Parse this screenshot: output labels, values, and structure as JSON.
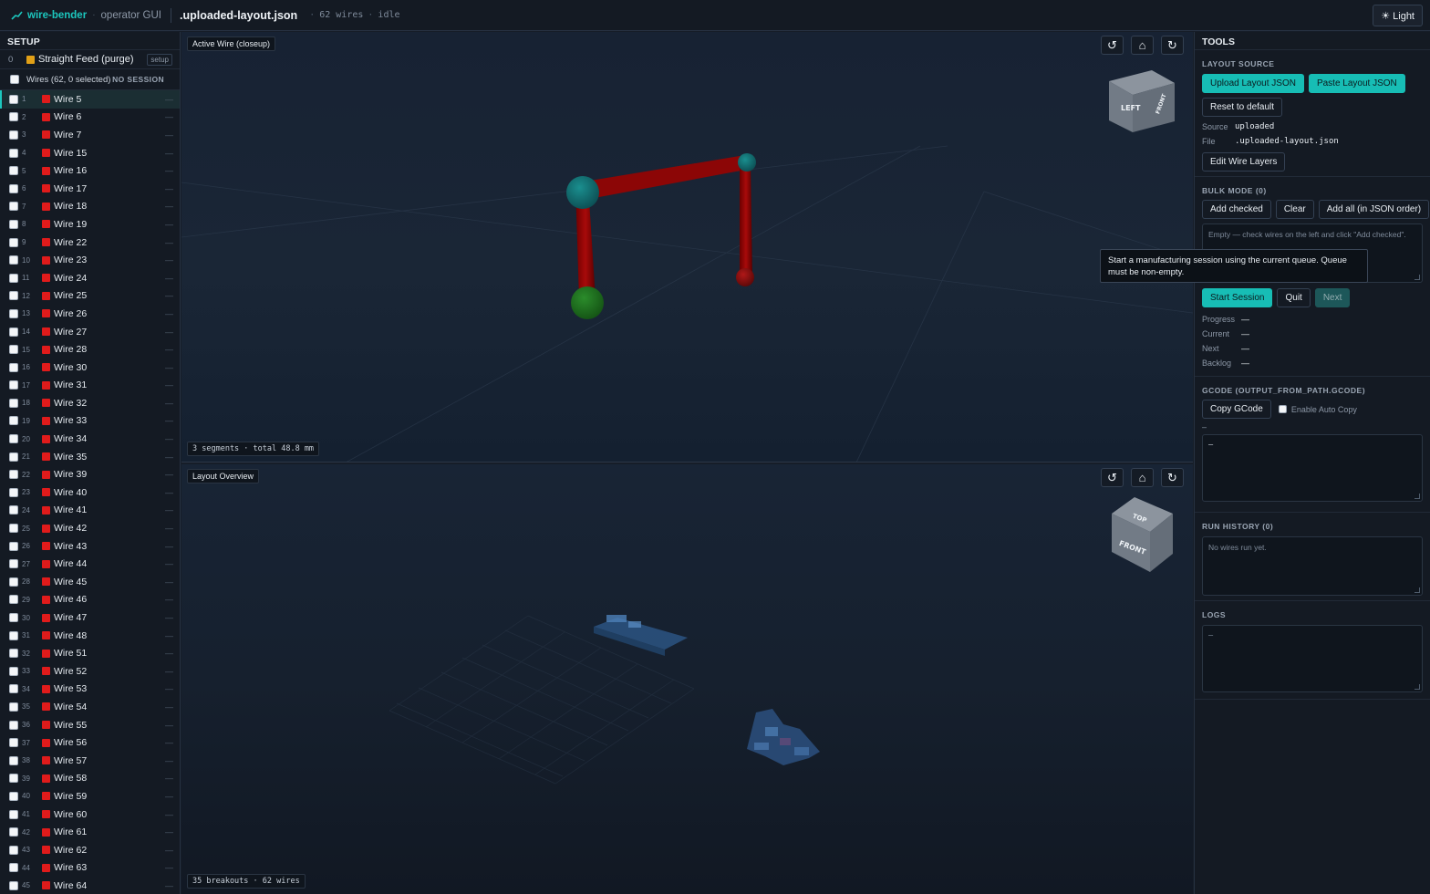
{
  "topbar": {
    "brand": "wire-bender",
    "subtitle": "operator GUI",
    "filename": ".uploaded-layout.json",
    "wire_count": "62 wires",
    "status": "idle",
    "theme_button": "☀ Light"
  },
  "sidebar": {
    "title": "SETUP",
    "setup_item": {
      "index": "0",
      "label": "Straight Feed (purge)",
      "tag": "setup",
      "color": "#e1a017"
    },
    "wires_header": {
      "label": "Wires (62, 0 selected)",
      "session": "NO SESSION"
    },
    "wire_color": "#e01b1b",
    "active_index": 0,
    "wires": [
      {
        "n": "1",
        "name": "Wire 5"
      },
      {
        "n": "2",
        "name": "Wire 6"
      },
      {
        "n": "3",
        "name": "Wire 7"
      },
      {
        "n": "4",
        "name": "Wire 15"
      },
      {
        "n": "5",
        "name": "Wire 16"
      },
      {
        "n": "6",
        "name": "Wire 17"
      },
      {
        "n": "7",
        "name": "Wire 18"
      },
      {
        "n": "8",
        "name": "Wire 19"
      },
      {
        "n": "9",
        "name": "Wire 22"
      },
      {
        "n": "10",
        "name": "Wire 23"
      },
      {
        "n": "11",
        "name": "Wire 24"
      },
      {
        "n": "12",
        "name": "Wire 25"
      },
      {
        "n": "13",
        "name": "Wire 26"
      },
      {
        "n": "14",
        "name": "Wire 27"
      },
      {
        "n": "15",
        "name": "Wire 28"
      },
      {
        "n": "16",
        "name": "Wire 30"
      },
      {
        "n": "17",
        "name": "Wire 31"
      },
      {
        "n": "18",
        "name": "Wire 32"
      },
      {
        "n": "19",
        "name": "Wire 33"
      },
      {
        "n": "20",
        "name": "Wire 34"
      },
      {
        "n": "21",
        "name": "Wire 35"
      },
      {
        "n": "22",
        "name": "Wire 39"
      },
      {
        "n": "23",
        "name": "Wire 40"
      },
      {
        "n": "24",
        "name": "Wire 41"
      },
      {
        "n": "25",
        "name": "Wire 42"
      },
      {
        "n": "26",
        "name": "Wire 43"
      },
      {
        "n": "27",
        "name": "Wire 44"
      },
      {
        "n": "28",
        "name": "Wire 45"
      },
      {
        "n": "29",
        "name": "Wire 46"
      },
      {
        "n": "30",
        "name": "Wire 47"
      },
      {
        "n": "31",
        "name": "Wire 48"
      },
      {
        "n": "32",
        "name": "Wire 51"
      },
      {
        "n": "33",
        "name": "Wire 52"
      },
      {
        "n": "34",
        "name": "Wire 53"
      },
      {
        "n": "35",
        "name": "Wire 54"
      },
      {
        "n": "36",
        "name": "Wire 55"
      },
      {
        "n": "37",
        "name": "Wire 56"
      },
      {
        "n": "38",
        "name": "Wire 57"
      },
      {
        "n": "39",
        "name": "Wire 58"
      },
      {
        "n": "40",
        "name": "Wire 59"
      },
      {
        "n": "41",
        "name": "Wire 60"
      },
      {
        "n": "42",
        "name": "Wire 61"
      },
      {
        "n": "43",
        "name": "Wire 62"
      },
      {
        "n": "44",
        "name": "Wire 63"
      },
      {
        "n": "45",
        "name": "Wire 64"
      }
    ],
    "row_trailing": "—"
  },
  "viewports": {
    "top": {
      "label": "Active Wire (closeup)",
      "stat": "3 segments · total 48.8 mm",
      "cube_faces": {
        "left": "LEFT",
        "front": "FRONT"
      }
    },
    "bottom": {
      "label": "Layout Overview",
      "stat": "35 breakouts · 62 wires",
      "cube_faces": {
        "top": "TOP",
        "front": "FRONT"
      }
    },
    "controls": {
      "rotate_left": "↺",
      "home": "⌂",
      "rotate_right": "↻"
    }
  },
  "tools": {
    "title": "TOOLS",
    "layout_source": {
      "title": "LAYOUT SOURCE",
      "upload": "Upload Layout JSON",
      "paste": "Paste Layout JSON",
      "reset": "Reset to default",
      "source_key": "Source",
      "source_val": "uploaded",
      "file_key": "File",
      "file_val": ".uploaded-layout.json",
      "edit_layers": "Edit Wire Layers"
    },
    "bulk": {
      "title": "BULK MODE (0)",
      "add_checked": "Add checked",
      "clear": "Clear",
      "add_all": "Add all (in JSON order)",
      "placeholder": "Empty — check wires on the left and click \"Add checked\".",
      "tooltip": "Start a manufacturing session using the current queue. Queue must be non-empty.",
      "start": "Start Session",
      "quit": "Quit",
      "next": "Next",
      "progress_key": "Progress",
      "progress_val": "—",
      "current_key": "Current",
      "current_val": "—",
      "next_key": "Next",
      "next_val": "—",
      "backlog_key": "Backlog",
      "backlog_val": "—"
    },
    "gcode": {
      "title": "GCODE (OUTPUT_FROM_PATH.GCODE)",
      "copy": "Copy GCode",
      "auto_copy": "Enable Auto Copy",
      "line": "–",
      "content": "–"
    },
    "history": {
      "title": "RUN HISTORY (0)",
      "content": "No wires run yet."
    },
    "logs": {
      "title": "LOGS",
      "content": "–"
    }
  }
}
